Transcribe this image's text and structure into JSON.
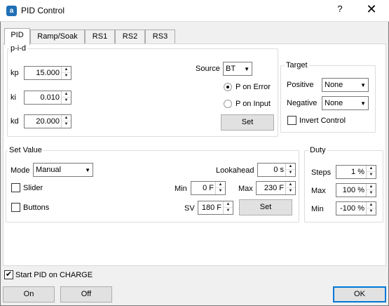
{
  "window": {
    "title": "PID Control",
    "app_icon_glyph": "a",
    "help_glyph": "?",
    "close_glyph": "✕"
  },
  "tabs": [
    {
      "label": "PID",
      "active": true
    },
    {
      "label": "Ramp/Soak",
      "active": false
    },
    {
      "label": "RS1",
      "active": false
    },
    {
      "label": "RS2",
      "active": false
    },
    {
      "label": "RS3",
      "active": false
    }
  ],
  "pid": {
    "group_label": "p-i-d",
    "kp": {
      "label": "kp",
      "value": "15.000"
    },
    "ki": {
      "label": "ki",
      "value": "0.010"
    },
    "kd": {
      "label": "kd",
      "value": "20.000"
    },
    "source": {
      "label": "Source",
      "value": "BT"
    },
    "p_on_error": {
      "label": "P on Error",
      "selected": true
    },
    "p_on_input": {
      "label": "P on Input",
      "selected": false
    },
    "set_button": "Set"
  },
  "target": {
    "group_label": "Target",
    "positive": {
      "label": "Positive",
      "value": "None"
    },
    "negative": {
      "label": "Negative",
      "value": "None"
    },
    "invert": {
      "label": "Invert Control",
      "checked": false
    }
  },
  "set_value": {
    "group_label": "Set Value",
    "mode": {
      "label": "Mode",
      "value": "Manual"
    },
    "lookahead": {
      "label": "Lookahead",
      "value": "0 s"
    },
    "slider": {
      "label": "Slider",
      "checked": false
    },
    "min": {
      "label": "Min",
      "value": "0 F"
    },
    "max": {
      "label": "Max",
      "value": "230 F"
    },
    "buttons": {
      "label": "Buttons",
      "checked": false
    },
    "sv": {
      "label": "SV",
      "value": "180 F"
    },
    "set_button": "Set"
  },
  "duty": {
    "group_label": "Duty",
    "steps": {
      "label": "Steps",
      "value": "1 %"
    },
    "max": {
      "label": "Max",
      "value": "100 %"
    },
    "min": {
      "label": "Min",
      "value": "-100 %"
    }
  },
  "footer": {
    "start_pid": {
      "label": "Start PID on CHARGE",
      "checked": true
    },
    "on_button": "On",
    "off_button": "Off",
    "ok_button": "OK"
  },
  "icons": {
    "spin_up": "▲",
    "spin_down": "▼",
    "combo_arrow": "▼",
    "check_mark": "✔"
  }
}
